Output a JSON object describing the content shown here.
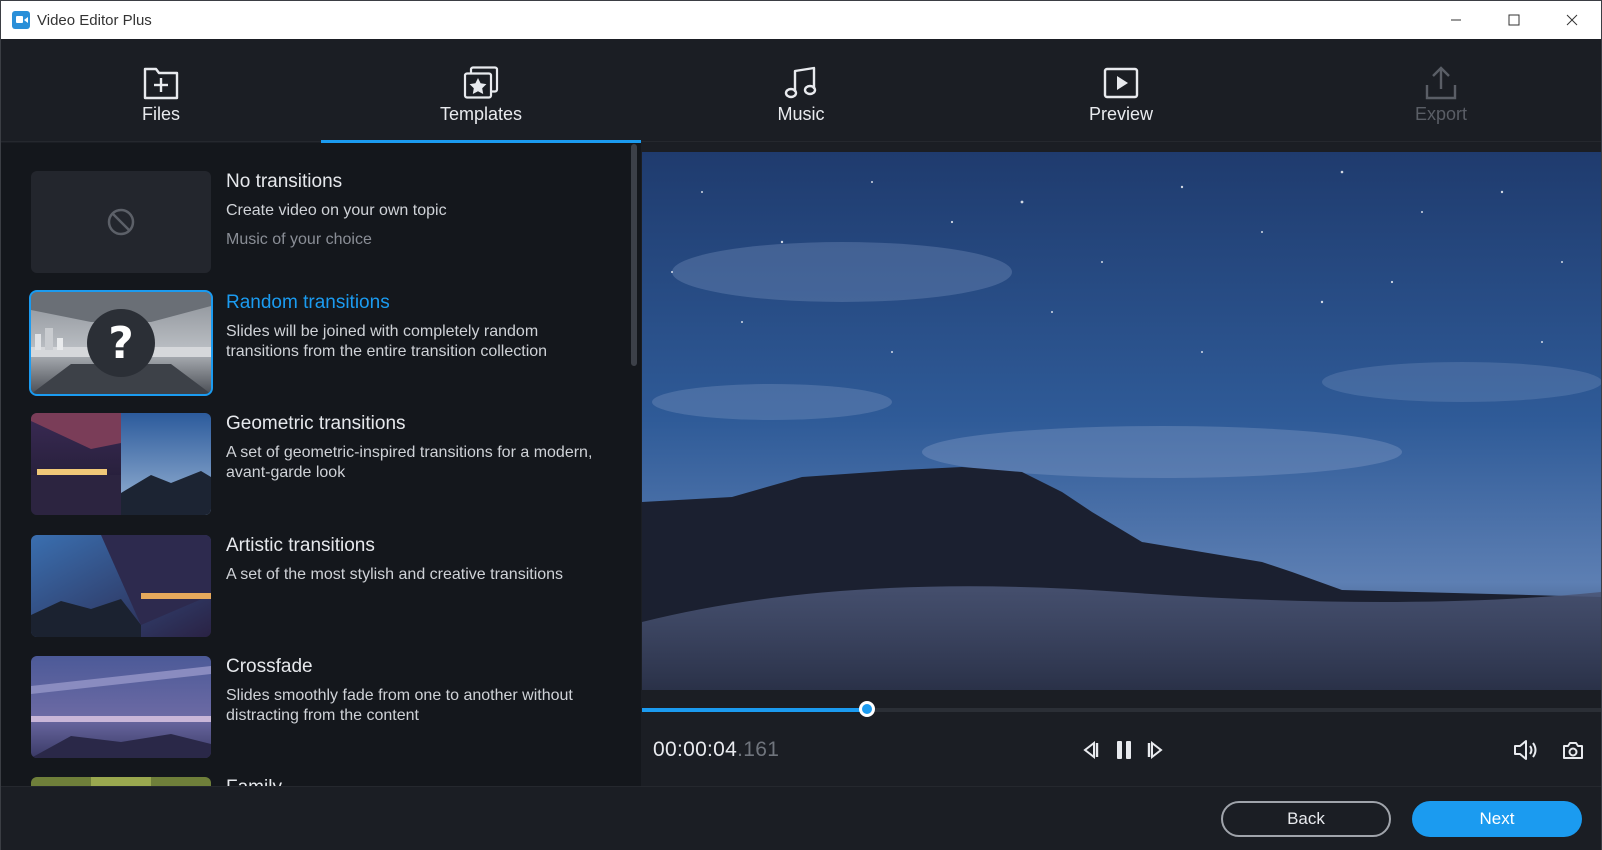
{
  "window": {
    "title": "Video Editor Plus",
    "controls": {
      "minimize": "minimize-icon",
      "maximize": "maximize-icon",
      "close": "close-icon"
    }
  },
  "nav": {
    "tabs": [
      {
        "label": "Files",
        "icon": "file-add-icon",
        "state": "normal"
      },
      {
        "label": "Templates",
        "icon": "templates-star-icon",
        "state": "active"
      },
      {
        "label": "Music",
        "icon": "music-note-icon",
        "state": "normal"
      },
      {
        "label": "Preview",
        "icon": "play-preview-icon",
        "state": "normal"
      },
      {
        "label": "Export",
        "icon": "export-upload-icon",
        "state": "disabled"
      }
    ]
  },
  "templates": [
    {
      "title": "No transitions",
      "description": "Create video on your own topic",
      "subtitle": "Music of your choice",
      "thumb": "no-symbol-icon"
    },
    {
      "title": "Random transitions",
      "description": "Slides will be joined with completely random transitions from the entire transition collection",
      "selected": true,
      "thumb": "question-mark-icon"
    },
    {
      "title": "Geometric transitions",
      "description": "A set of geometric-inspired transitions for a modern, avant-garde look"
    },
    {
      "title": "Artistic transitions",
      "description": "A set of the most stylish and creative transitions"
    },
    {
      "title": "Crossfade",
      "description": "Slides smoothly fade from one to another without distracting from the content"
    },
    {
      "title": "Family",
      "description": ""
    }
  ],
  "player": {
    "time_main": "00:00:04",
    "time_ms": ".161",
    "progress_fraction": 0.235,
    "controls": [
      "step-back-icon",
      "pause-icon",
      "step-forward-icon",
      "volume-icon",
      "snapshot-camera-icon"
    ]
  },
  "footer": {
    "back_label": "Back",
    "next_label": "Next"
  },
  "colors": {
    "accent": "#1b9bf0",
    "background": "#1b1e24",
    "panel": "#14171c"
  }
}
